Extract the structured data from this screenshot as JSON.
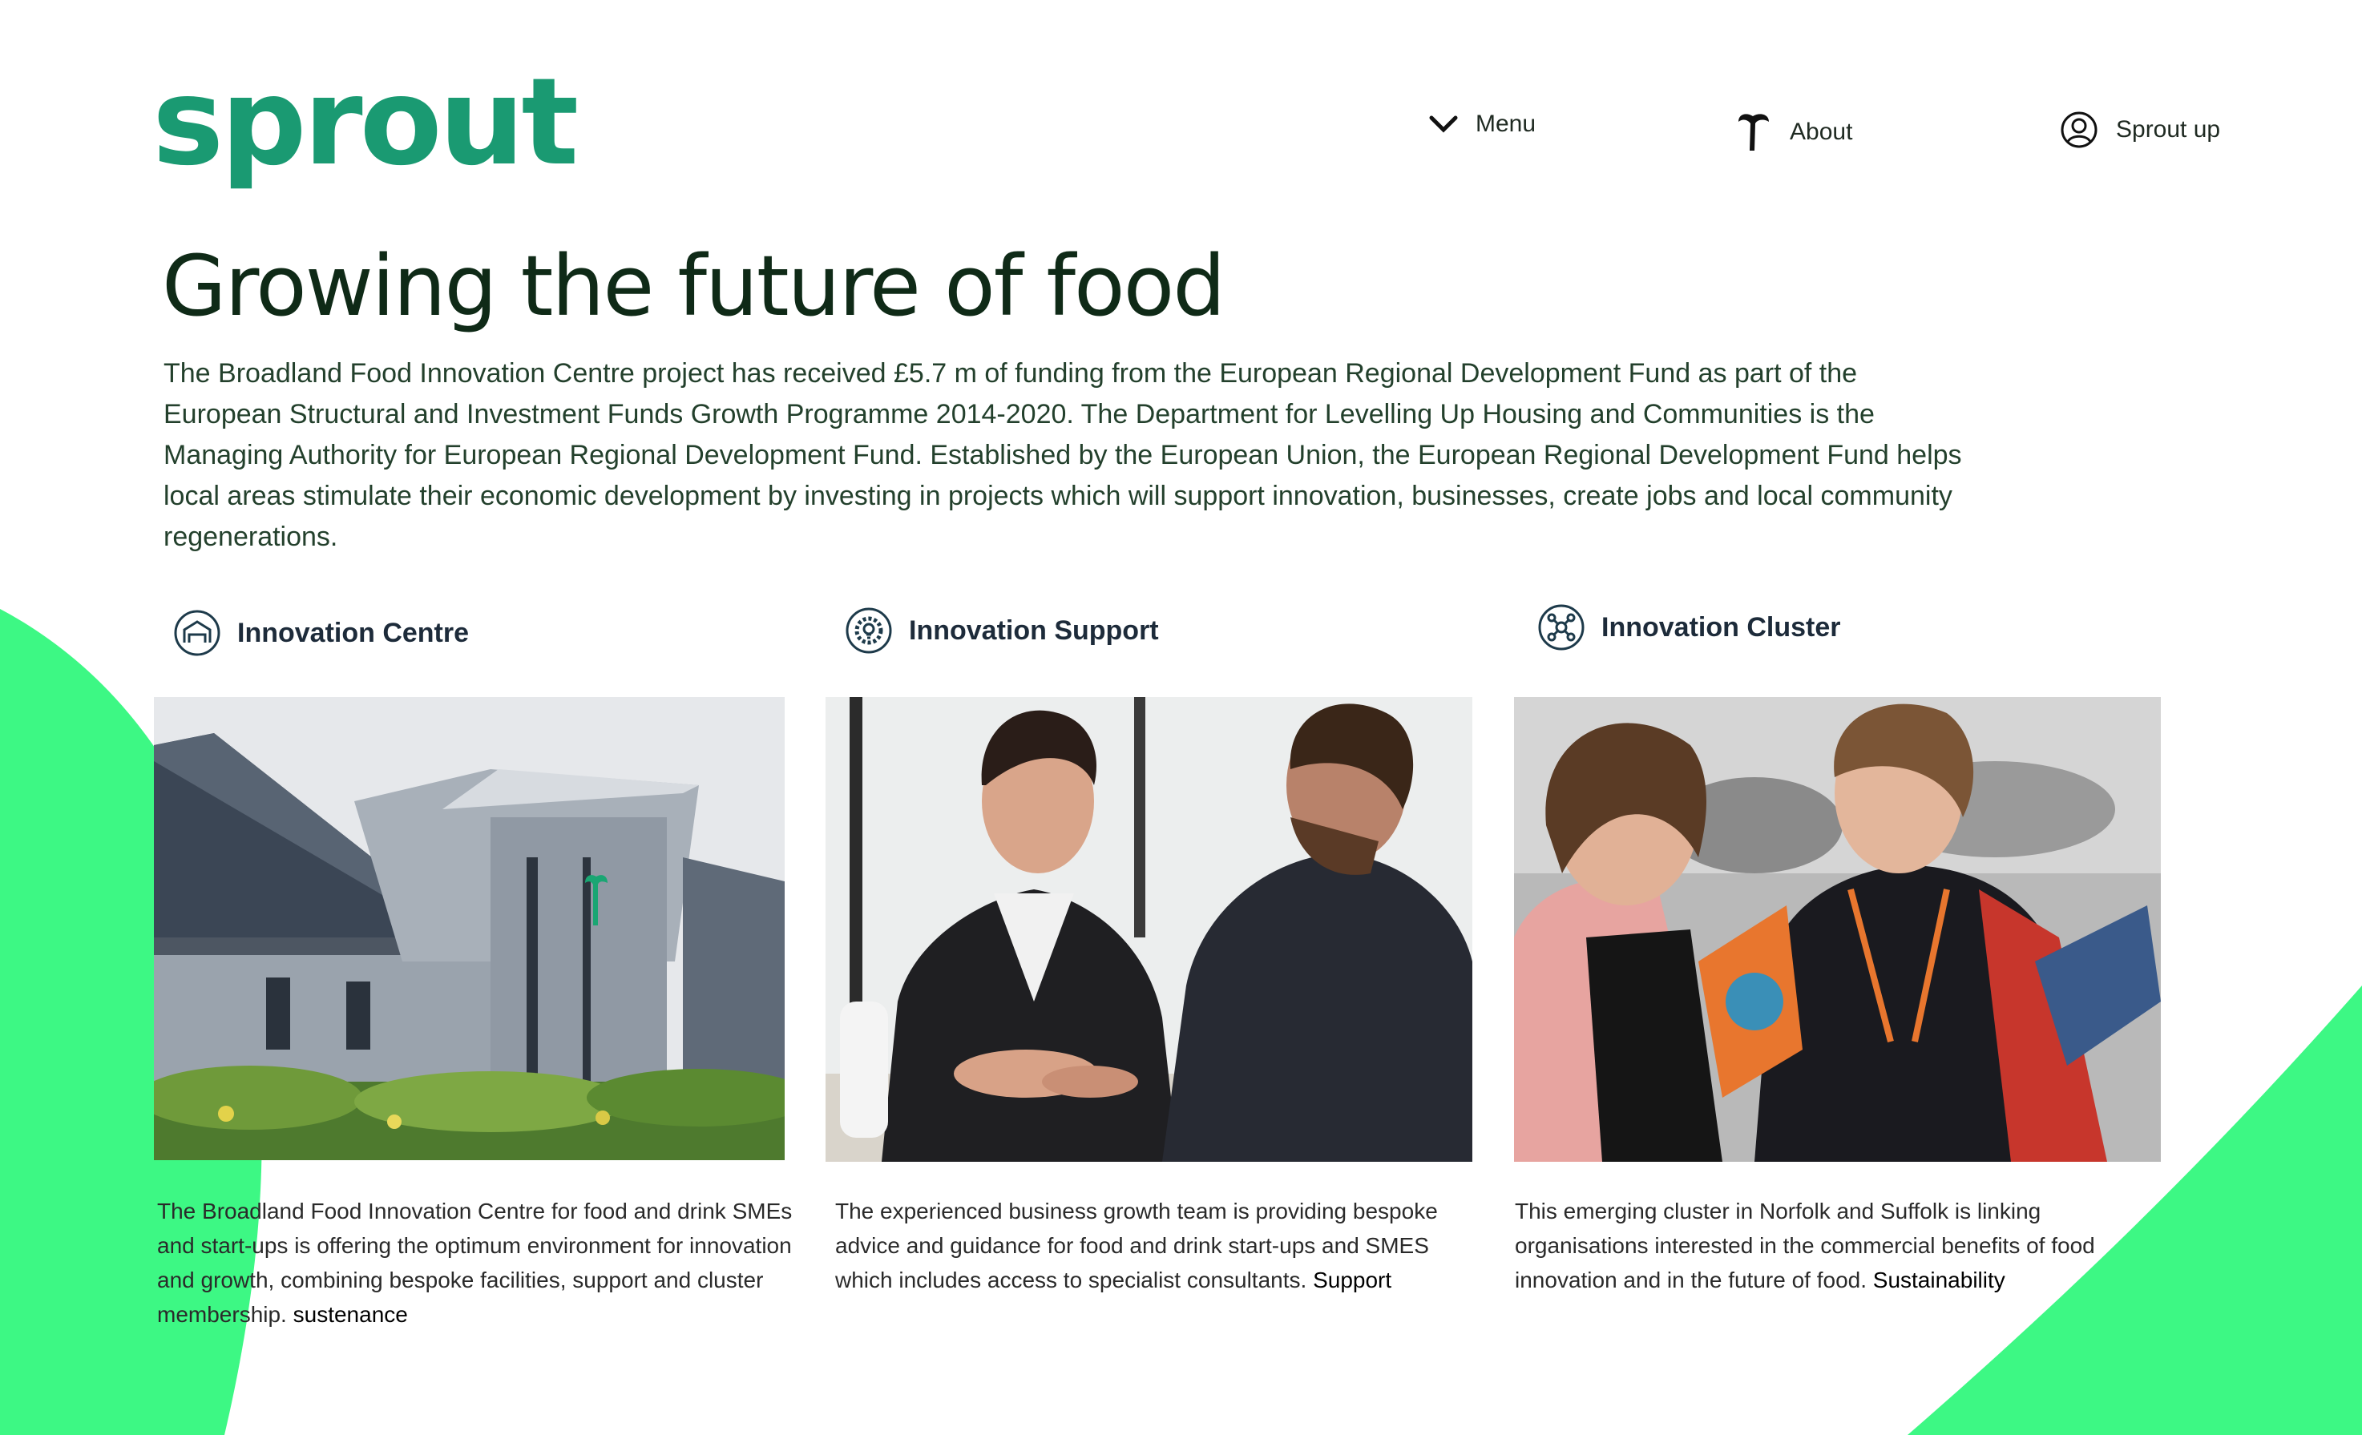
{
  "brand": {
    "logo_text": "sprout",
    "accent": "#1a9a72",
    "blob_color": "#3df884"
  },
  "nav": {
    "menu_label": "Menu",
    "about_label": "About",
    "sprout_up_label": "Sprout up"
  },
  "hero": {
    "title": "Growing the future of food",
    "intro": "The Broadland Food Innovation Centre project has received £5.7 m of funding from the European Regional Development Fund as part of the European Structural and Investment Funds Growth Programme 2014-2020. The Department for Levelling Up Housing and Communities is the  Managing Authority for European Regional Development Fund. Established by the European Union, the European Regional Development Fund helps local areas stimulate their economic development by investing in projects which will support innovation, businesses, create jobs and local community regenerations."
  },
  "columns": [
    {
      "heading": "Innovation Centre",
      "icon": "building-icon",
      "text": "The Broadland Food Innovation Centre for food and drink SMEs and start-ups is offering the optimum environment for innovation and growth, combining bespoke facilities, support and cluster membership. ",
      "link": "sustenance"
    },
    {
      "heading": "Innovation Support",
      "icon": "gear-bulb-icon",
      "text": "The experienced business growth team is providing bespoke advice and guidance for food and drink start-ups and SMES which includes access to specialist consultants. ",
      "link": "Support"
    },
    {
      "heading": "Innovation Cluster",
      "icon": "network-icon",
      "text": "This emerging cluster in Norfolk and Suffolk is linking organisations interested in the commercial benefits of food innovation and in the future of food. ",
      "link": "Sustainability"
    }
  ]
}
